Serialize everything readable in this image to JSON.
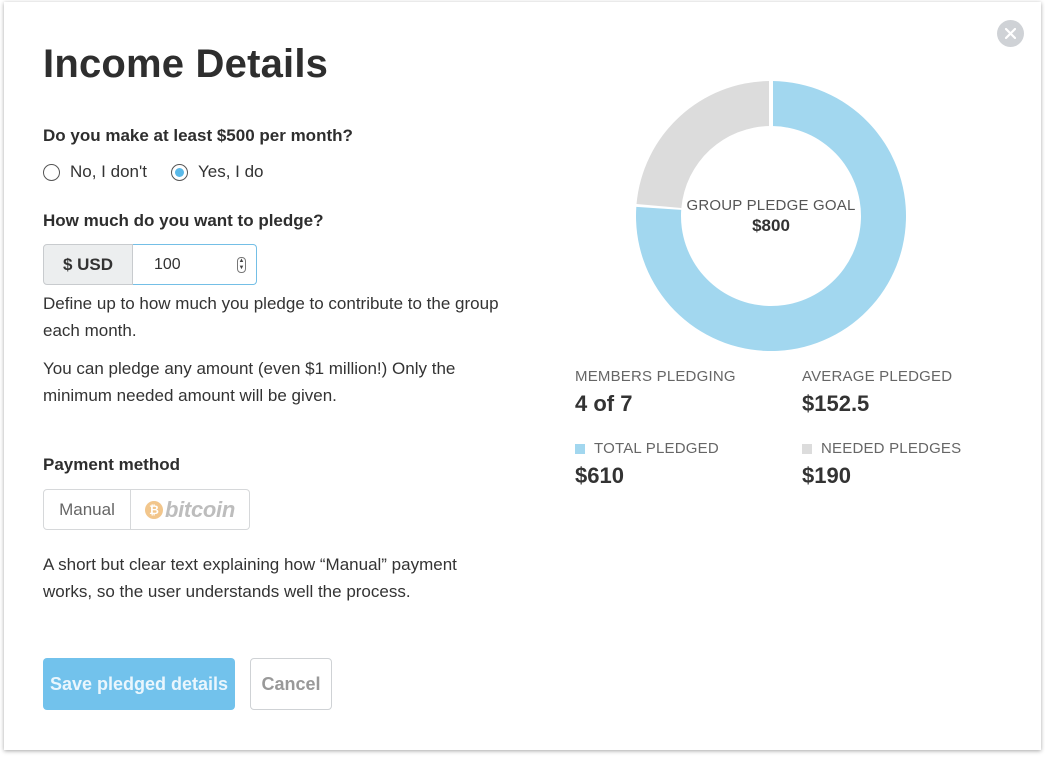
{
  "modal": {
    "title": "Income Details",
    "close_icon": "close-icon"
  },
  "income_question": {
    "label": "Do you make at least $500 per month?",
    "options": [
      {
        "label": "No, I don't",
        "selected": false
      },
      {
        "label": "Yes, I do",
        "selected": true
      }
    ]
  },
  "pledge": {
    "label": "How much do you want to pledge?",
    "currency": "$ USD",
    "amount": "100",
    "help_1": "Define up to how much you pledge to contribute to the group each month.",
    "help_2": "You can pledge any amount (even $1 million!) Only the minimum needed amount will be given."
  },
  "payment": {
    "label": "Payment method",
    "options": [
      {
        "label": "Manual",
        "selected": true
      },
      {
        "label": "bitcoin",
        "icon": "bitcoin-icon",
        "selected": false
      }
    ],
    "description": "A short but clear text explaining how “Manual” payment works, so the user understands well the process."
  },
  "actions": {
    "save_label": "Save pledged details",
    "cancel_label": "Cancel"
  },
  "chart_data": {
    "type": "pie",
    "center_label": "GROUP PLEDGE GOAL",
    "center_value": "$800",
    "goal": 800,
    "slices": [
      {
        "name": "TOTAL PLEDGED",
        "value": 610,
        "color": "#a2d7ef"
      },
      {
        "name": "NEEDED PLEDGES",
        "value": 190,
        "color": "#dcdcdc"
      }
    ]
  },
  "stats": {
    "members_label": "MEMBERS PLEDGING",
    "members_value": "4 of 7",
    "average_label": "AVERAGE PLEDGED",
    "average_value": "$152.5",
    "total_label": "TOTAL PLEDGED",
    "total_value": "$610",
    "needed_label": "NEEDED PLEDGES",
    "needed_value": "$190"
  },
  "colors": {
    "accent": "#72c2ec",
    "pledged": "#a2d7ef",
    "needed": "#dcdcdc"
  }
}
